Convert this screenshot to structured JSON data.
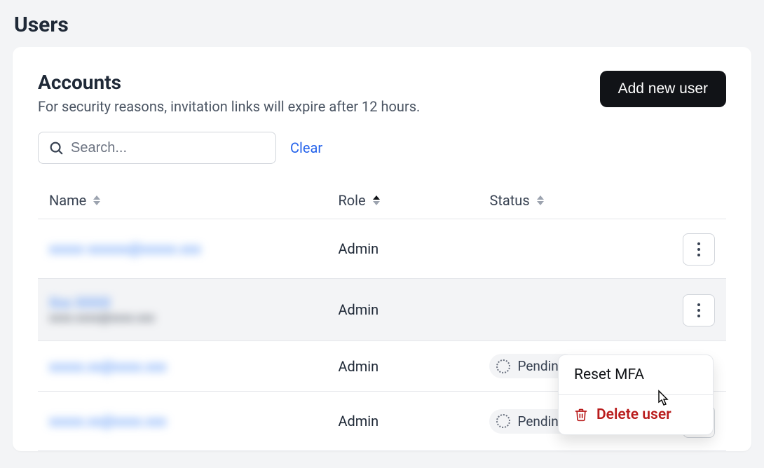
{
  "page": {
    "title": "Users"
  },
  "card": {
    "title": "Accounts",
    "subtitle": "For security reasons, invitation links will expire after 12 hours.",
    "add_button": "Add new user"
  },
  "search": {
    "placeholder": "Search...",
    "clear": "Clear"
  },
  "columns": {
    "name": "Name",
    "role": "Role",
    "status": "Status"
  },
  "rows": [
    {
      "name_masked": "xxxxx xxxxxx@xxxxx.xxx",
      "role": "Admin",
      "status": null
    },
    {
      "name_masked": "Xxx XXXX",
      "sub_masked": "xxxx.xxxx@xxxx.xxx",
      "role": "Admin",
      "status": null
    },
    {
      "name_masked": "xxxxx.xx@xxxx.xxx",
      "role": "Admin",
      "status": "Pending"
    },
    {
      "name_masked": "xxxxx.xx@xxxx.xxx",
      "role": "Admin",
      "status": "Pending"
    }
  ],
  "menu": {
    "reset": "Reset MFA",
    "delete": "Delete user"
  }
}
